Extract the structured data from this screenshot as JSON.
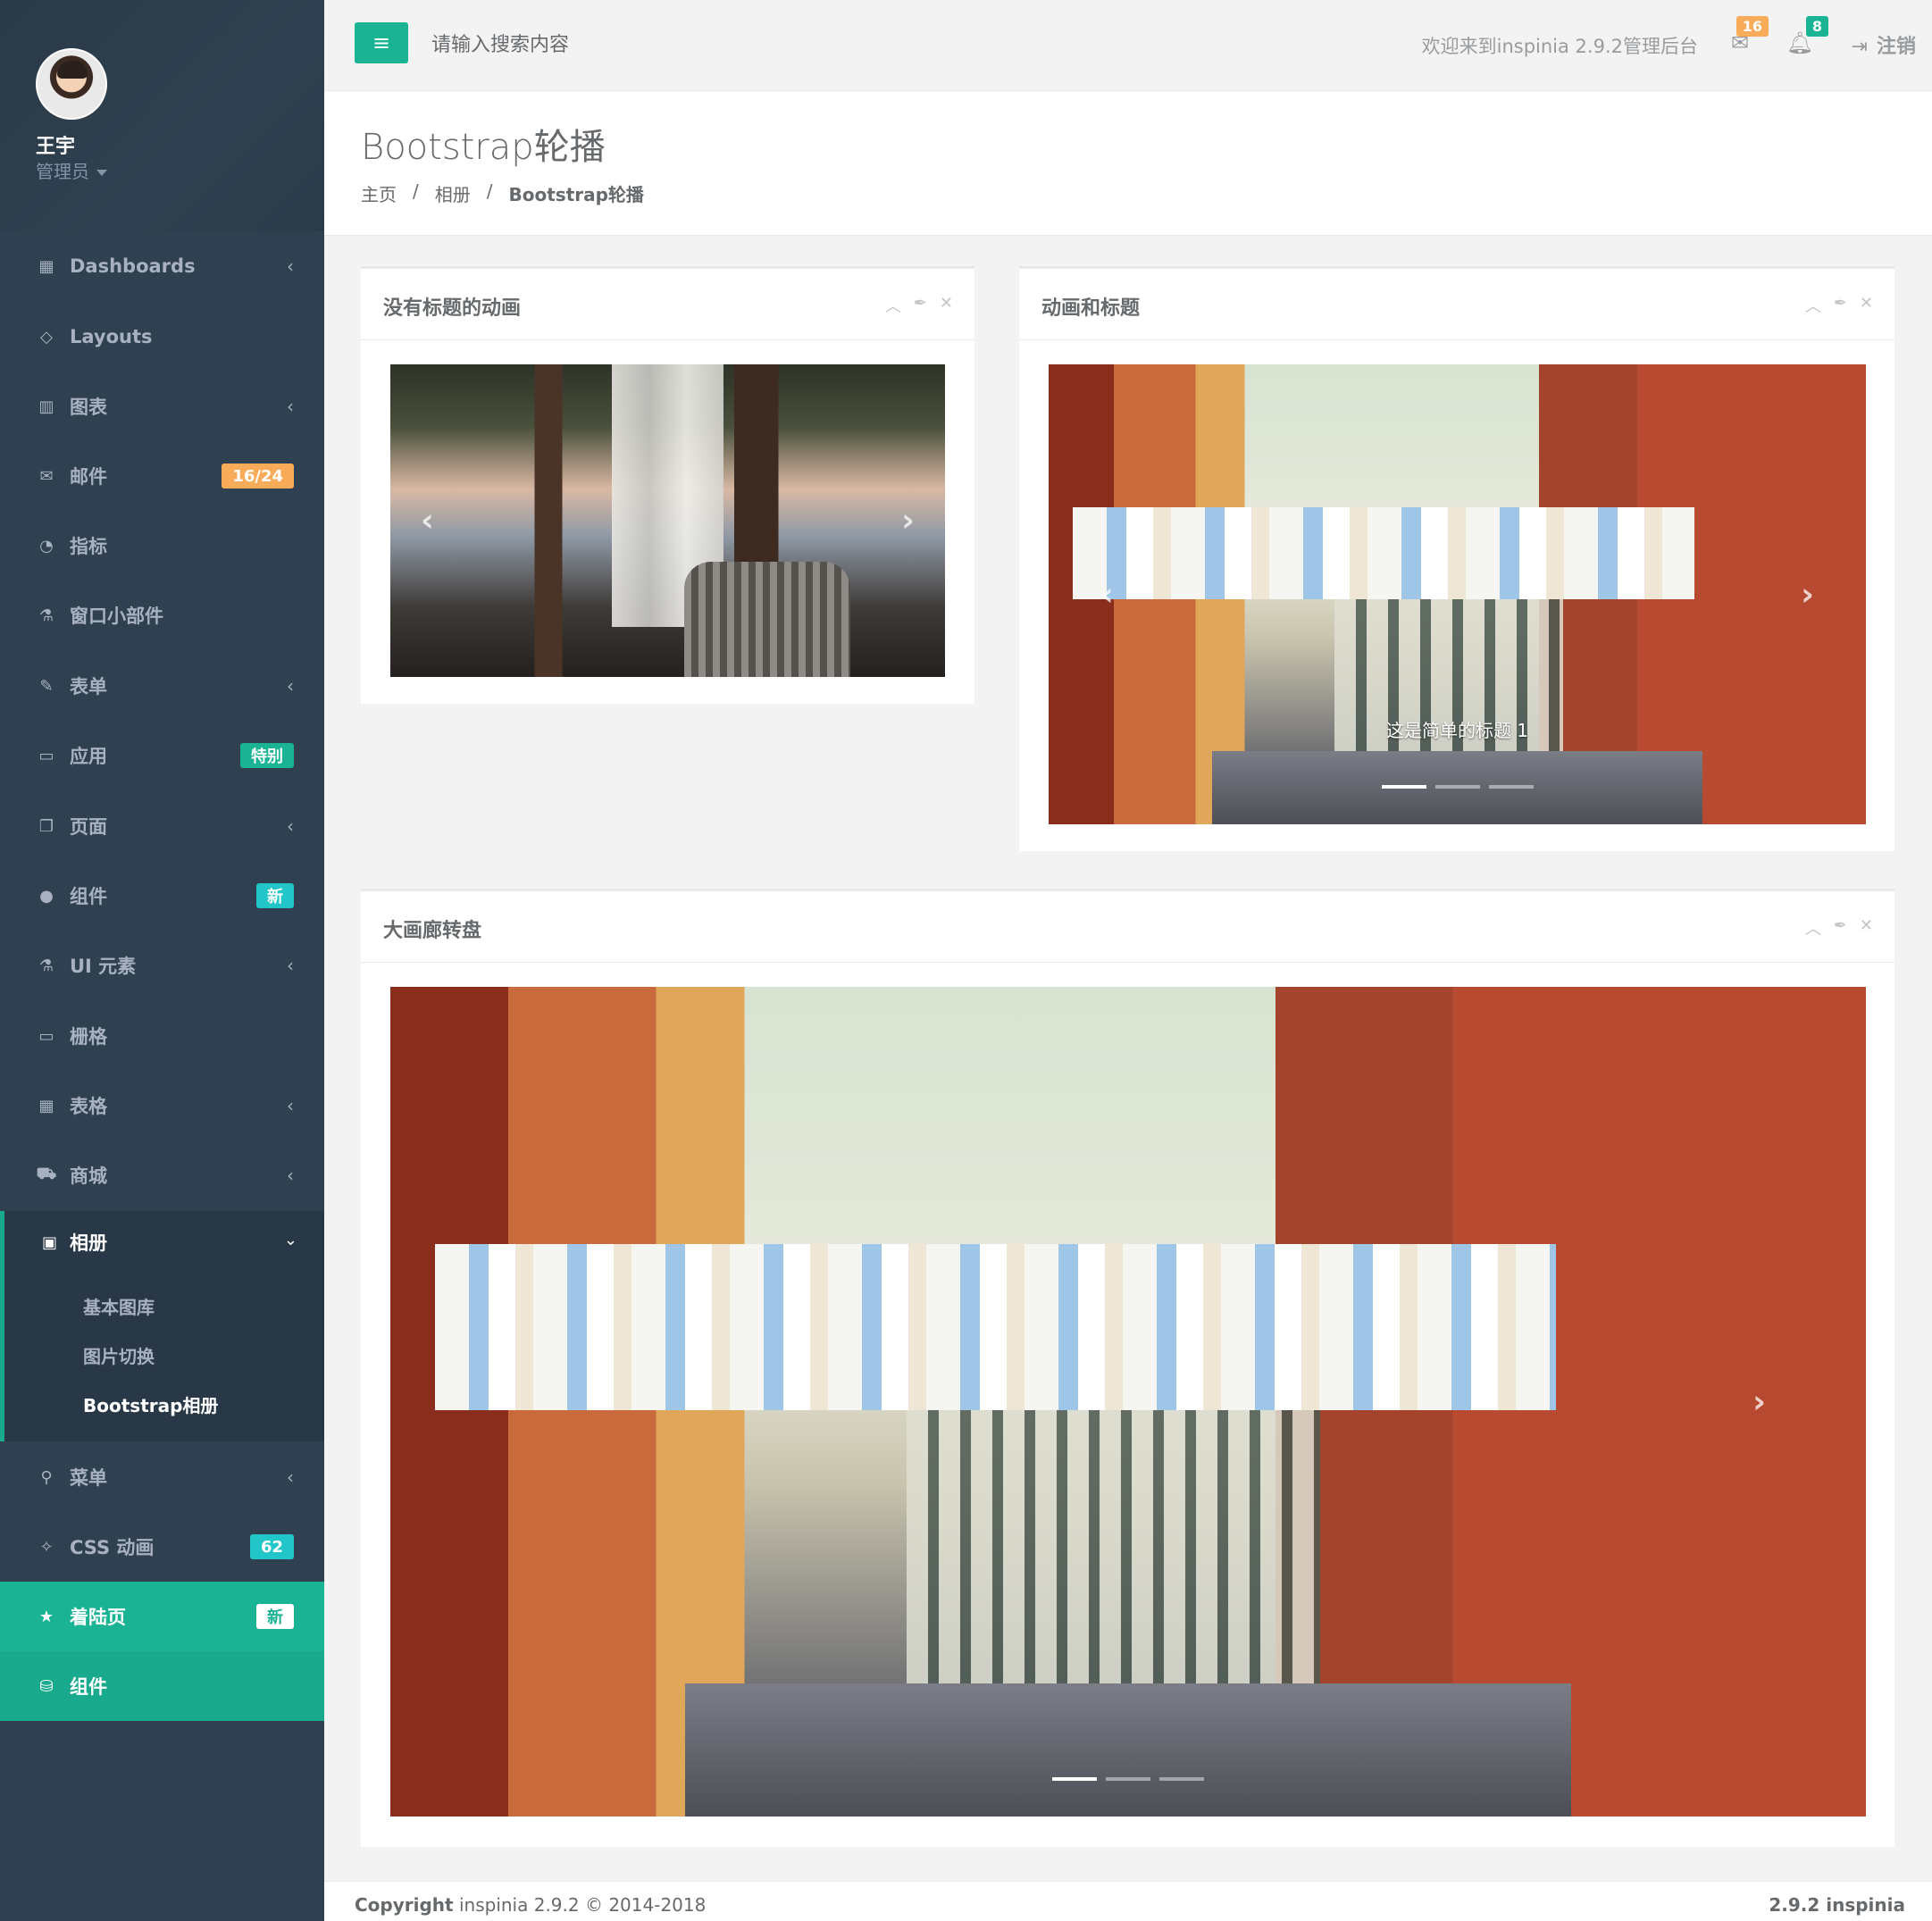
{
  "user": {
    "name": "王宇",
    "role": "管理员"
  },
  "nav": [
    {
      "label": "Dashboards",
      "icon": "th-large-icon"
    },
    {
      "label": "Layouts",
      "icon": "diamond-icon"
    },
    {
      "label": "图表",
      "icon": "bar-chart-icon"
    },
    {
      "label": "邮件",
      "icon": "envelope-icon",
      "badge": "16/24"
    },
    {
      "label": "指标",
      "icon": "pie-chart-icon"
    },
    {
      "label": "窗口小部件",
      "icon": "flask-icon"
    },
    {
      "label": "表单",
      "icon": "edit-icon"
    },
    {
      "label": "应用",
      "icon": "desktop-icon",
      "badge": "特别"
    },
    {
      "label": "页面",
      "icon": "files-icon"
    },
    {
      "label": "组件",
      "icon": "globe-icon",
      "badge": "新"
    },
    {
      "label": "UI 元素",
      "icon": "flask-icon"
    },
    {
      "label": "栅格",
      "icon": "laptop-icon"
    },
    {
      "label": "表格",
      "icon": "table-icon"
    },
    {
      "label": "商城",
      "icon": "cart-icon"
    }
  ],
  "gallery": {
    "label": "相册",
    "sub": [
      "基本图库",
      "图片切换",
      "Bootstrap相册"
    ]
  },
  "nav_bottom": [
    {
      "label": "菜单",
      "icon": "sitemap-icon"
    },
    {
      "label": "CSS 动画",
      "icon": "magic-icon",
      "badge": "62"
    },
    {
      "label": "着陆页",
      "icon": "star-icon",
      "badge": "新"
    },
    {
      "label": "组件",
      "icon": "database-icon"
    }
  ],
  "colors": {
    "accent": "#1ab394",
    "warning": "#f8ac59",
    "info": "#23c6c8",
    "sidebar": "#2f4050"
  },
  "topbar": {
    "search_placeholder": "请输入搜索内容",
    "welcome": "欢迎来到inspinia 2.9.2管理后台",
    "mail_count": "16",
    "alert_count": "8",
    "logout": "注销"
  },
  "page": {
    "title": "Bootstrap轮播",
    "breadcrumb": [
      "主页",
      "相册",
      "Bootstrap轮播"
    ]
  },
  "panels": {
    "p1_title": "没有标题的动画",
    "p2_title": "动画和标题",
    "p2_caption": "这是简单的标题 1",
    "p3_title": "大画廊转盘"
  },
  "footer": {
    "left_bold": "Copyright",
    "left_text": "inspinia 2.9.2 © 2014-2018",
    "right": "2.9.2 inspinia"
  }
}
